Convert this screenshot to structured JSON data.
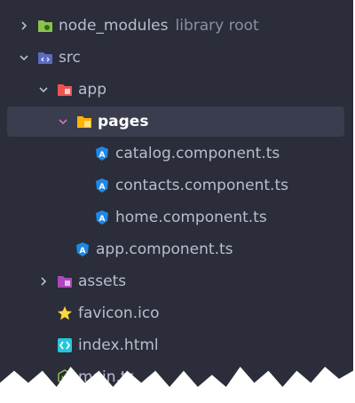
{
  "tree": {
    "items": [
      {
        "label": "node_modules",
        "note": "library root",
        "icon": "folder-node-icon"
      },
      {
        "label": "src",
        "icon": "folder-src-icon"
      },
      {
        "label": "app",
        "icon": "folder-app-icon"
      },
      {
        "label": "pages",
        "icon": "folder-icon",
        "selected": true
      },
      {
        "label": "catalog.component.ts",
        "icon": "angular-icon"
      },
      {
        "label": "contacts.component.ts",
        "icon": "angular-icon"
      },
      {
        "label": "home.component.ts",
        "icon": "angular-icon"
      },
      {
        "label": "app.component.ts",
        "icon": "angular-icon"
      },
      {
        "label": "assets",
        "icon": "folder-assets-icon"
      },
      {
        "label": "favicon.ico",
        "icon": "star-icon"
      },
      {
        "label": "index.html",
        "icon": "html-icon"
      },
      {
        "label": "main.ts",
        "icon": "nodejs-icon"
      }
    ]
  },
  "colors": {
    "background": "#2b2d3a",
    "selection": "#3a3d4d",
    "text": "#b9bdd0",
    "angular": "#1e88e5"
  }
}
